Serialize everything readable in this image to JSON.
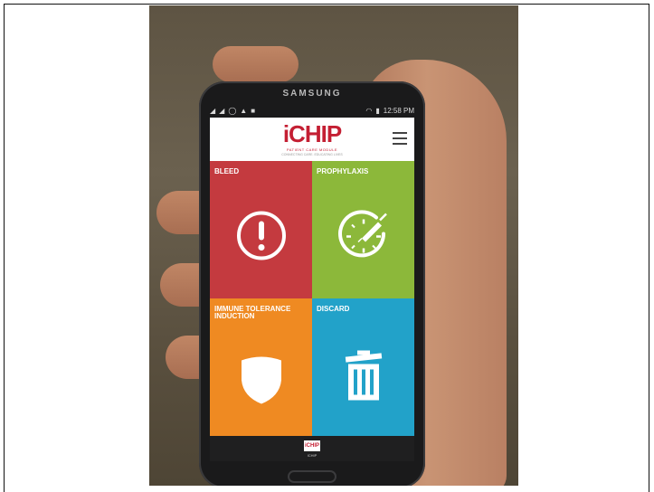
{
  "phone": {
    "brand": "SAMSUNG",
    "status_time": "12:58 PM"
  },
  "app": {
    "logo": "iCHIP",
    "logo_tagline": "PATIENT CARE MODULE",
    "logo_subtagline": "CONNECTING CARE. EDUCATING LIVES",
    "bottom_logo": "iCHIP",
    "bottom_caption": "ICHIP"
  },
  "tiles": [
    {
      "label": "BLEED",
      "color": "#c43a3f",
      "icon": "exclamation-circle-icon"
    },
    {
      "label": "PROPHYLAXIS",
      "color": "#8cb83a",
      "icon": "syringe-clock-icon"
    },
    {
      "label": "IMMUNE TOLERANCE INDUCTION",
      "color": "#ef8a22",
      "icon": "shield-icon"
    },
    {
      "label": "DISCARD",
      "color": "#22a2c9",
      "icon": "trash-icon"
    }
  ]
}
